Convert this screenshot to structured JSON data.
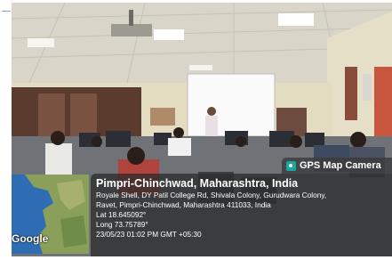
{
  "gps_tag": {
    "label": "GPS Map Camera",
    "icon": "camera-pin-icon"
  },
  "location": {
    "city": "Pimpri-Chinchwad, Maharashtra, India",
    "address_line1": "Royale Shell, DY Patil College Rd, Shivala Colony, Gurudwara Colony,",
    "address_line2": "Ravet, Pimpri-Chinchwad, Maharashtra 411033, India",
    "lat": "Lat 18.645092°",
    "long": "Long 73.75789°",
    "datetime": "23/05/23 01:02 PM GMT +05:30"
  },
  "map": {
    "provider_label": "Google"
  },
  "colors": {
    "overlay_bg": "#2d2d2d",
    "map_sea": "#2e6db4",
    "map_land": "#8aa05a",
    "gps_icon": "#1aa7a1"
  }
}
